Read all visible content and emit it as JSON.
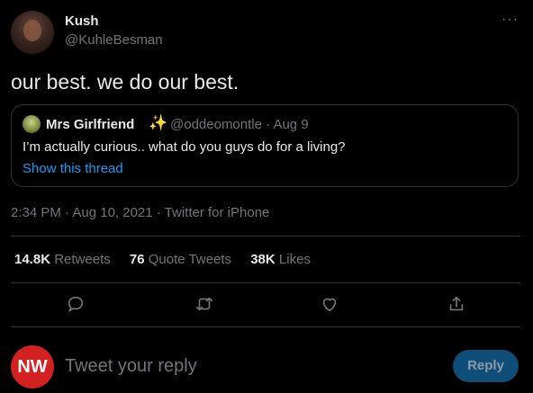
{
  "author": {
    "name": "Kush",
    "handle": "@KuhleBesman"
  },
  "tweet": {
    "text": "our best. we do our best.",
    "meta": "2:34 PM · Aug 10, 2021 · Twitter for iPhone"
  },
  "quote": {
    "name": "Mrs Girlfriend",
    "emoji": "✨",
    "handle_date": "@oddeomontle · Aug 9",
    "text": "I’m actually curious.. what do you guys do for a living?",
    "show_thread": "Show this thread"
  },
  "stats": [
    {
      "num": "14.8K",
      "label": "Retweets"
    },
    {
      "num": "76",
      "label": "Quote Tweets"
    },
    {
      "num": "38K",
      "label": "Likes"
    }
  ],
  "actions": [
    "reply-icon",
    "retweet-icon",
    "like-icon",
    "share-icon"
  ],
  "reply": {
    "avatar_text": "NW",
    "placeholder": "Tweet your reply",
    "button": "Reply"
  },
  "colors": {
    "background": "#000000",
    "accent": "#1d9bf0",
    "muted": "#71767b",
    "avatar_red": "#d32020"
  }
}
